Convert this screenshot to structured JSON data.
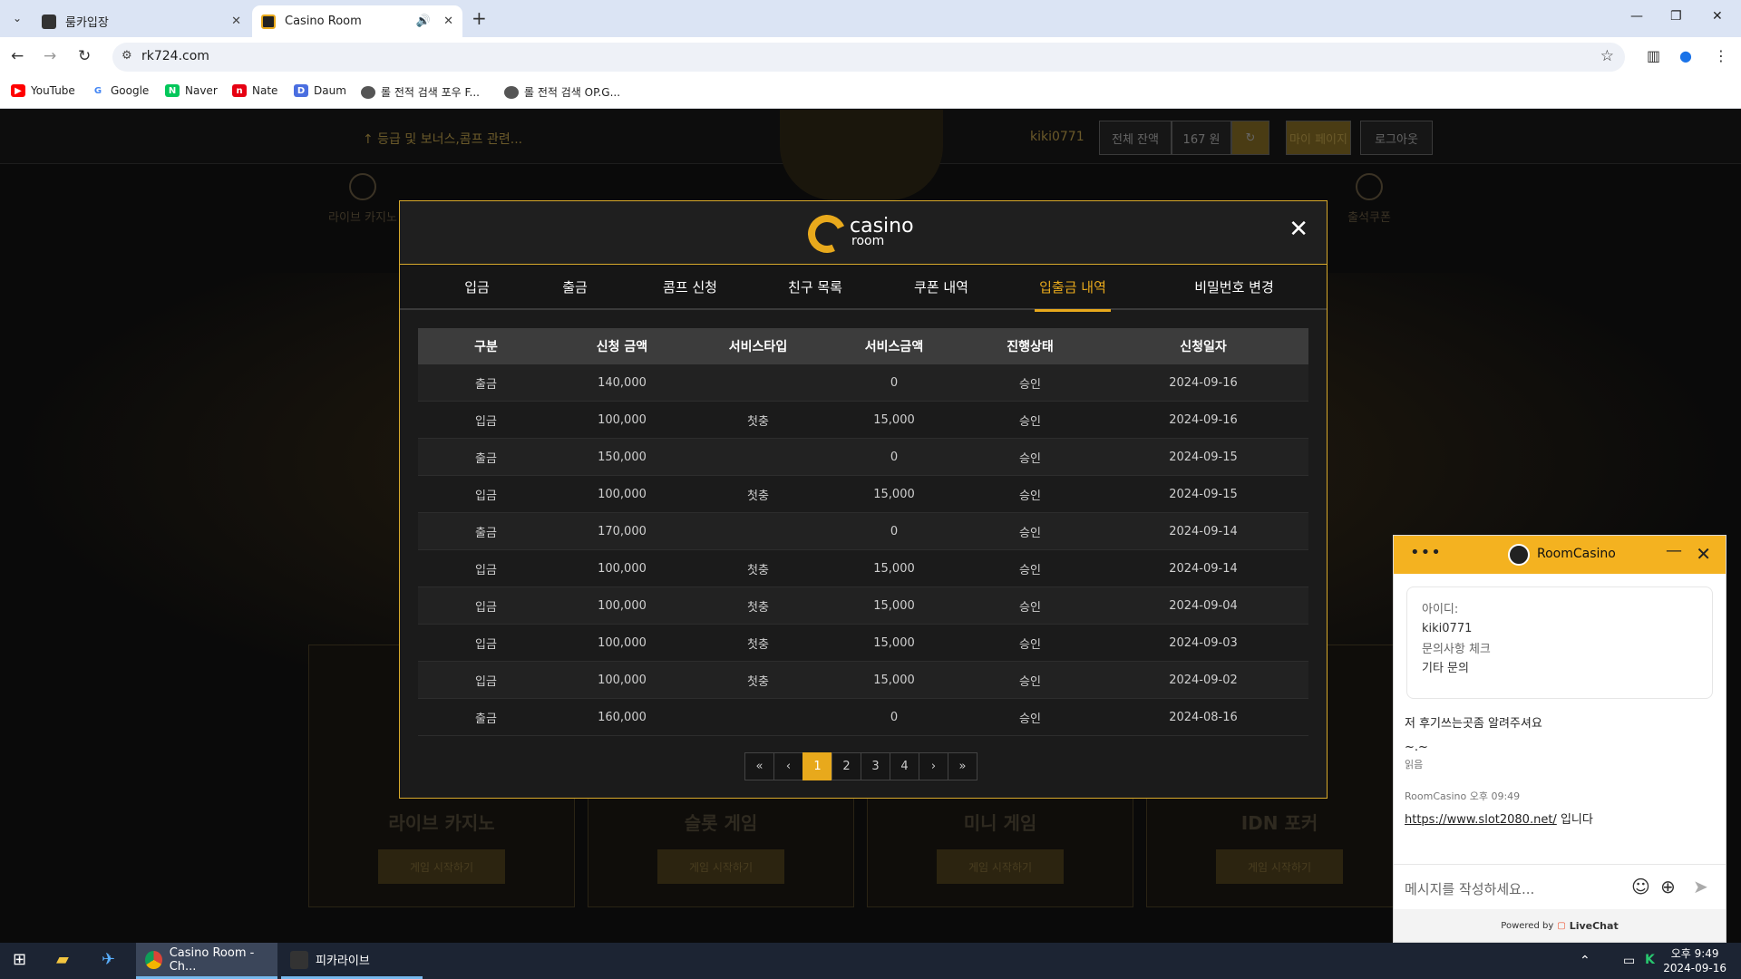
{
  "browser": {
    "tabs": [
      {
        "title": "룸카입장",
        "active": false
      },
      {
        "title": "Casino Room",
        "active": true
      }
    ],
    "url": "rk724.com",
    "bookmarks": [
      "YouTube",
      "Google",
      "Naver",
      "Nate",
      "Daum",
      "롤 전적 검색 포우 F...",
      "롤 전적 검색 OP.G..."
    ]
  },
  "background_page": {
    "notice": "↑ 등급 및 보너스,콤프 관련...",
    "user": "kiki0771",
    "balance_label": "전체 잔액",
    "balance_value": "167 원",
    "mypage": "마이 페이지",
    "logout": "로그아웃",
    "nav": [
      "라이브 카지노",
      "출석쿠폰"
    ],
    "cards": [
      {
        "title": "라이브 카지노",
        "btn": "게임 시작하기"
      },
      {
        "title": "슬롯 게임",
        "btn": "게임 시작하기"
      },
      {
        "title": "미니 게임",
        "btn": "게임 시작하기"
      },
      {
        "title": "IDN 포커",
        "btn": "게임 시작하기"
      }
    ]
  },
  "modal": {
    "logo_line1": "casino",
    "logo_line2": "room",
    "tabs": [
      "입금",
      "출금",
      "콤프 신청",
      "친구 목록",
      "쿠폰 내역",
      "입출금 내역",
      "비밀번호 변경"
    ],
    "active_tab": "입출금 내역",
    "table": {
      "headers": [
        "구분",
        "신청 금액",
        "서비스타입",
        "서비스금액",
        "진행상태",
        "신청일자"
      ],
      "rows": [
        [
          "출금",
          "140,000",
          "",
          "0",
          "승인",
          "2024-09-16"
        ],
        [
          "입금",
          "100,000",
          "첫충",
          "15,000",
          "승인",
          "2024-09-16"
        ],
        [
          "출금",
          "150,000",
          "",
          "0",
          "승인",
          "2024-09-15"
        ],
        [
          "입금",
          "100,000",
          "첫충",
          "15,000",
          "승인",
          "2024-09-15"
        ],
        [
          "출금",
          "170,000",
          "",
          "0",
          "승인",
          "2024-09-14"
        ],
        [
          "입금",
          "100,000",
          "첫충",
          "15,000",
          "승인",
          "2024-09-14"
        ],
        [
          "입금",
          "100,000",
          "첫충",
          "15,000",
          "승인",
          "2024-09-04"
        ],
        [
          "입금",
          "100,000",
          "첫충",
          "15,000",
          "승인",
          "2024-09-03"
        ],
        [
          "입금",
          "100,000",
          "첫충",
          "15,000",
          "승인",
          "2024-09-02"
        ],
        [
          "출금",
          "160,000",
          "",
          "0",
          "승인",
          "2024-08-16"
        ]
      ]
    },
    "pagination": {
      "first": "«",
      "prev": "‹",
      "pages": [
        "1",
        "2",
        "3",
        "4"
      ],
      "current": "1",
      "next": "›",
      "last": "»"
    }
  },
  "chat": {
    "title": "RoomCasino",
    "id_label": "아이디:",
    "id_value": "kiki0771",
    "inquiry_label": "문의사항 체크",
    "inquiry_value": "기타 문의",
    "user_msg": "저 후기쓰는곳좀 알려주셔요",
    "user_msg2": "~.~",
    "read": "읽음",
    "agent_meta": "RoomCasino 오후 09:49",
    "agent_link": "https://www.slot2080.net/",
    "agent_suffix": " 입니다",
    "input_placeholder": "메시지를 작성하세요...",
    "powered_by": "Powered by",
    "brand": "LiveChat"
  },
  "taskbar": {
    "apps": [
      "Casino Room - Ch...",
      "피카라이브"
    ],
    "time": "오후 9:49",
    "date": "2024-09-16"
  },
  "colors": {
    "accent": "#e8a91c",
    "chat_header": "#f4b220",
    "taskbar": "#1c2433"
  }
}
